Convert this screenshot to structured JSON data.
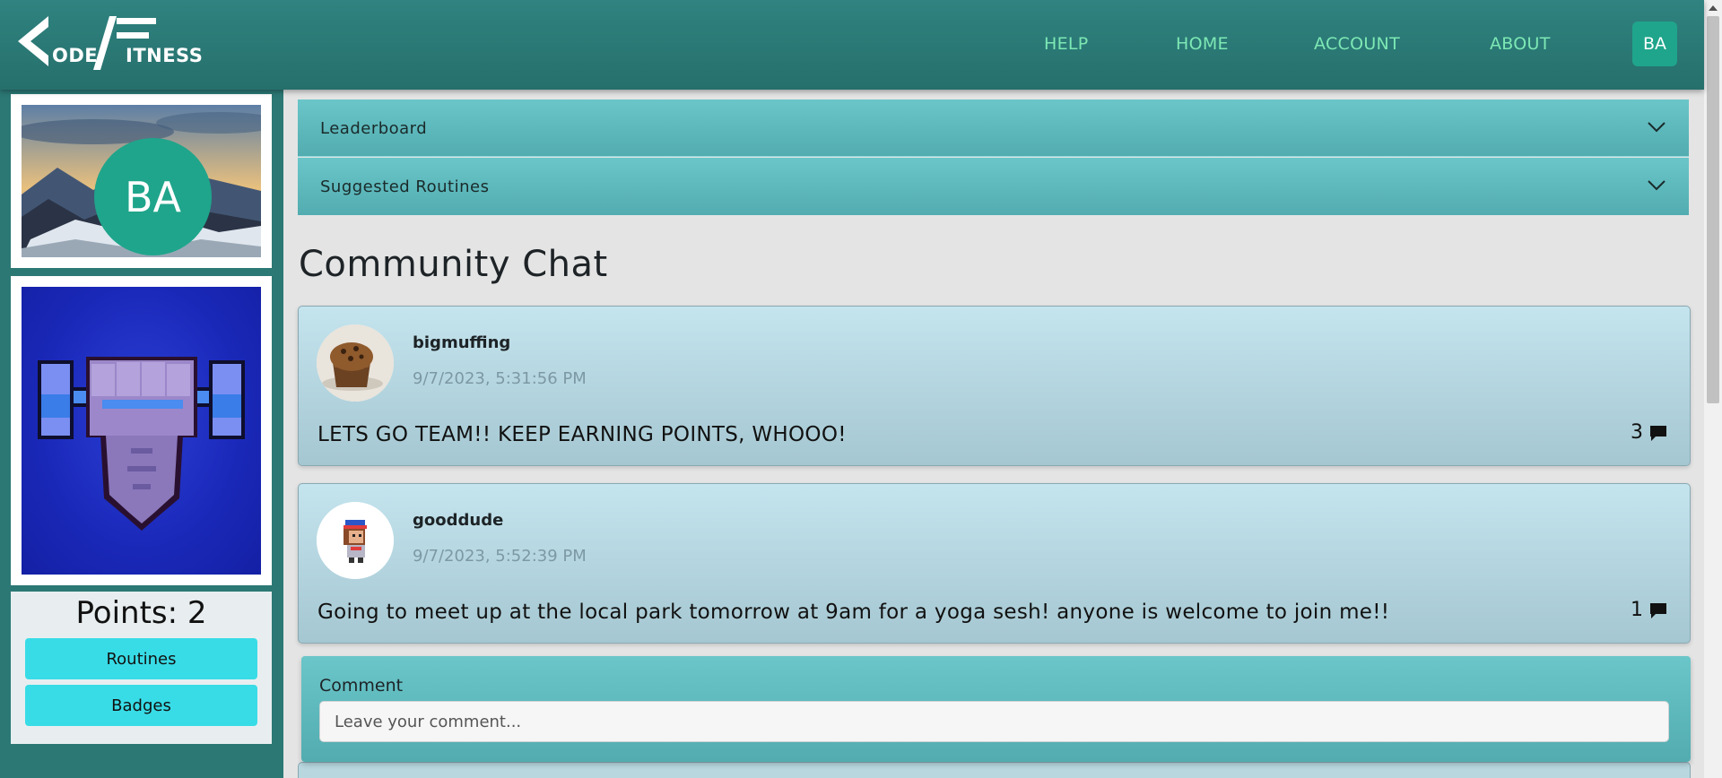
{
  "header": {
    "logo_text_1": "ODE",
    "logo_text_2": "ITNESS",
    "nav": [
      "HELP",
      "HOME",
      "ACCOUNT",
      "ABOUT"
    ],
    "avatar_initials": "BA"
  },
  "sidebar": {
    "profile_initials": "BA",
    "points_label": "Points: 2",
    "buttons": [
      "Routines",
      "Badges"
    ]
  },
  "main": {
    "accordions": [
      "Leaderboard",
      "Suggested Routines"
    ],
    "chat_title": "Community Chat",
    "posts": [
      {
        "user": "bigmuffing",
        "time": "9/7/2023, 5:31:56 PM",
        "text": "LETS GO TEAM!! KEEP EARNING POINTS, WHOOO!",
        "count": "3"
      },
      {
        "user": "gooddude",
        "time": "9/7/2023, 5:52:39 PM",
        "text": "Going to meet up at the local park tomorrow at 9am for a yoga sesh! anyone is welcome to join me!!",
        "count": "1"
      }
    ],
    "comment": {
      "label": "Comment",
      "placeholder": "Leave your comment..."
    }
  },
  "colors": {
    "header": "#2f8380",
    "nav_link": "#7de8b4",
    "avatar": "#1fa58b",
    "side_button": "#38dce6",
    "accordion": "#5fbbbe",
    "post": "#b8d7df"
  }
}
